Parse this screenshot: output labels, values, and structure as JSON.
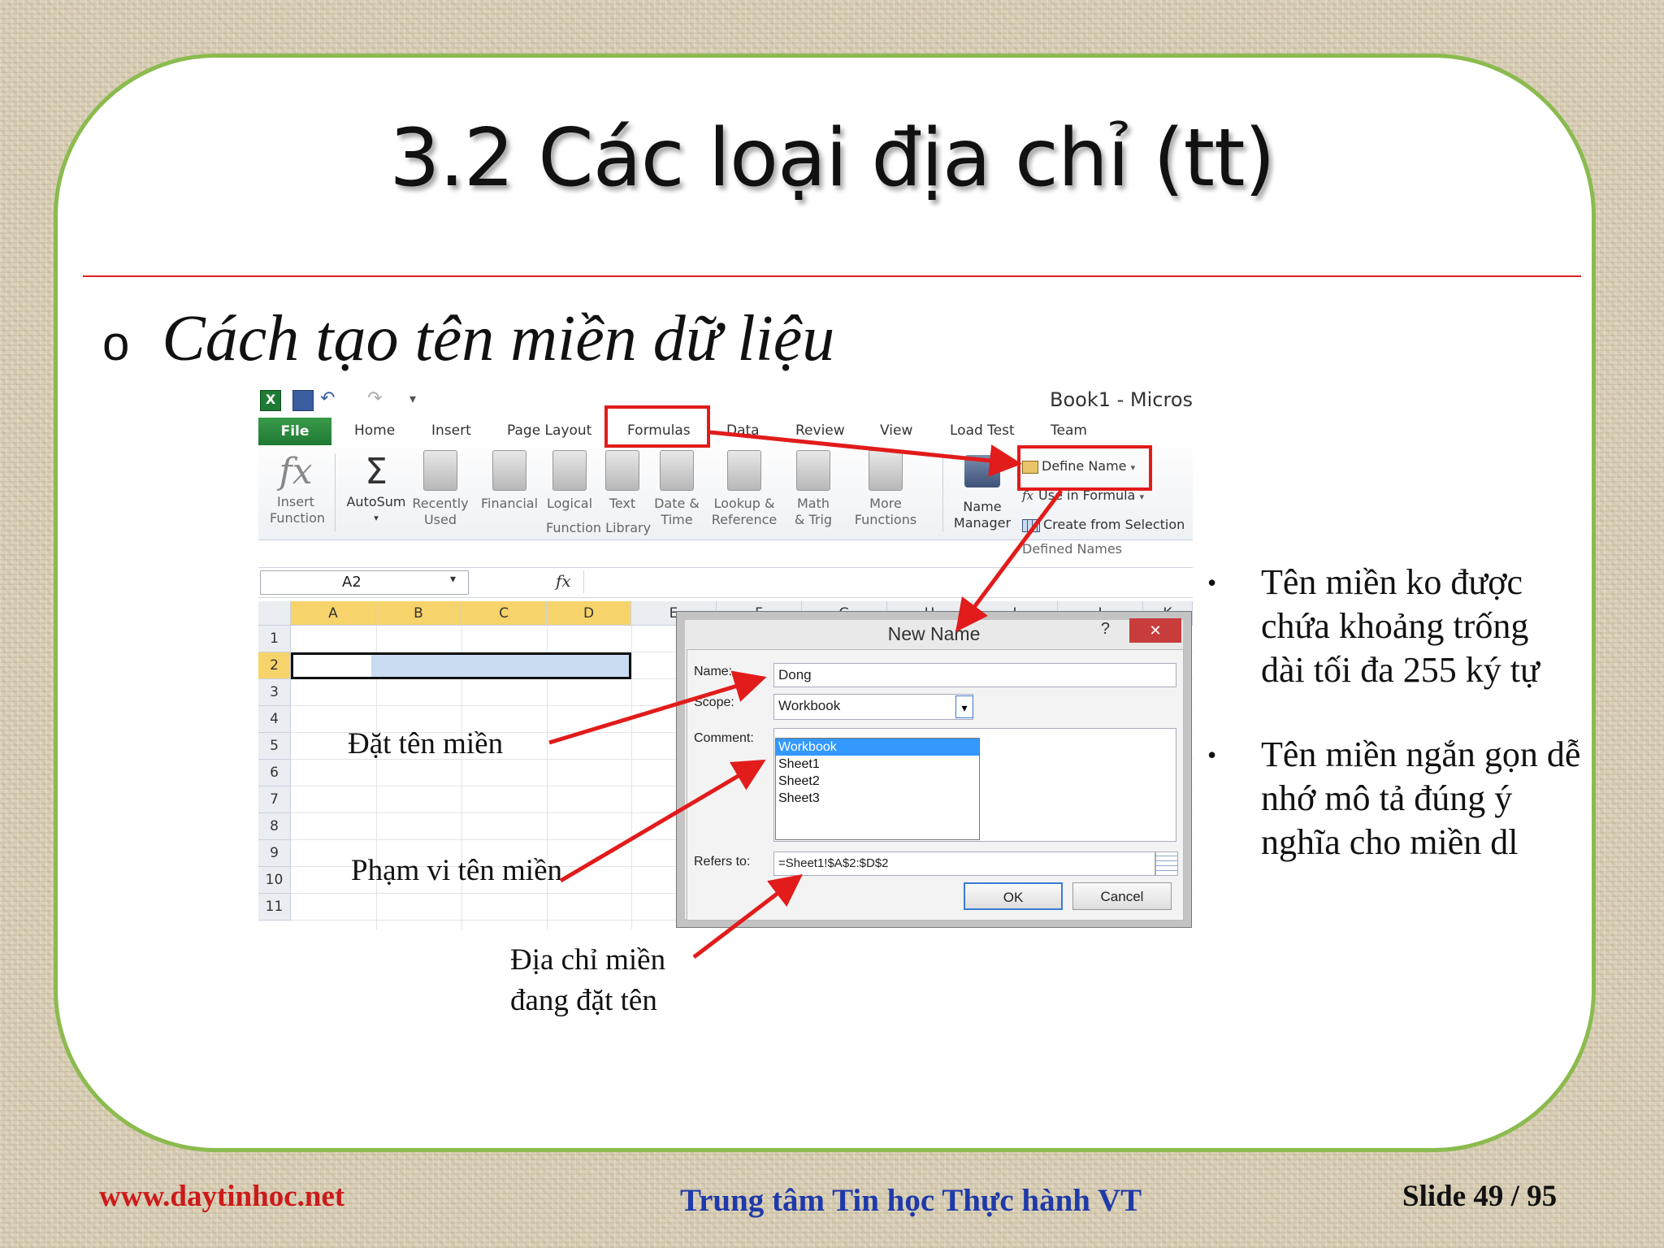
{
  "slide": {
    "title": "3.2 Các loại địa chỉ (tt)",
    "bullet_marker": "o",
    "heading": "Cách tạo tên miền dữ liệu",
    "side_bullets": [
      "Tên miền ko được chứa khoảng trống dài tối đa 255 ký tự",
      "Tên miền ngắn gọn dễ nhớ mô tả đúng ý nghĩa cho miền dl"
    ],
    "annotations": {
      "name": "Đặt tên miền",
      "scope": "Phạm vi tên miền",
      "address_line1": "Địa chỉ miền",
      "address_line2": "đang đặt tên"
    },
    "footer": {
      "website": "www.daytinhoc.net",
      "center": "Trung tâm Tin học Thực hành VT",
      "slide_number": "Slide 49  / 95"
    },
    "colors": {
      "frame": "#8bbb4e",
      "rule": "#dd2222",
      "arrow": "#e21b1b",
      "footer_left": "#cc1a1a",
      "footer_center": "#1f3aa8"
    }
  },
  "excel": {
    "window_title": "Book1  -  Micros",
    "tabs": [
      "File",
      "Home",
      "Insert",
      "Page Layout",
      "Formulas",
      "Data",
      "Review",
      "View",
      "Load Test",
      "Team"
    ],
    "ribbon": {
      "insert_function": [
        "Insert",
        "Function"
      ],
      "autosum": "AutoSum",
      "recently_used": [
        "Recently",
        "Used"
      ],
      "financial": "Financial",
      "logical": "Logical",
      "text": "Text",
      "date_time": [
        "Date &",
        "Time"
      ],
      "lookup_reference": [
        "Lookup &",
        "Reference"
      ],
      "math_trig": [
        "Math",
        "& Trig"
      ],
      "more_functions": [
        "More",
        "Functions"
      ],
      "group_function_library": "Function Library",
      "name_manager": [
        "Name",
        "Manager"
      ],
      "define_name": "Define Name",
      "use_in_formula": "Use in Formula",
      "create_from_selection": "Create from Selection",
      "group_defined_names": "Defined Names"
    },
    "formula_bar": {
      "namebox": "A2",
      "fx": "fx"
    },
    "columns": [
      "A",
      "B",
      "C",
      "D",
      "E",
      "F",
      "G",
      "H",
      "I",
      "J",
      "K"
    ],
    "rows": [
      "1",
      "2",
      "3",
      "4",
      "5",
      "6",
      "7",
      "8",
      "9",
      "10",
      "11"
    ],
    "dialog": {
      "title": "New Name",
      "help": "?",
      "close": "✕",
      "name_label": "Name:",
      "name_value": "Dong",
      "scope_label": "Scope:",
      "scope_value": "Workbook",
      "comment_label": "Comment:",
      "scope_options": [
        "Workbook",
        "Sheet1",
        "Sheet2",
        "Sheet3"
      ],
      "refers_label": "Refers to:",
      "refers_value": "=Sheet1!$A$2:$D$2",
      "ok": "OK",
      "cancel": "Cancel"
    }
  }
}
